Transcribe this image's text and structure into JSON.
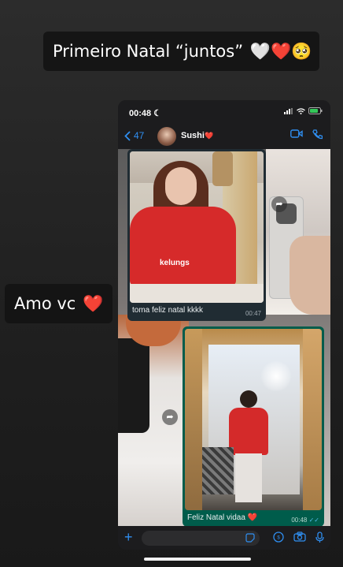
{
  "story": {
    "caption_top": "Primeiro Natal “juntos”",
    "caption_top_emoji": "🤍❤️🥺",
    "caption_mid": "Amo vc",
    "caption_mid_emoji": "❤️"
  },
  "status_bar": {
    "time": "00:48",
    "moon": "☾"
  },
  "chat_header": {
    "back_count": "47",
    "contact_name": "Sushi",
    "contact_emoji": "❤️"
  },
  "messages": [
    {
      "caption": "toma feliz natal kkkk",
      "time": "00:47",
      "direction": "incoming"
    },
    {
      "caption": "Feliz Natal vidaa",
      "caption_emoji": "❤️",
      "time": "00:48",
      "direction": "outgoing"
    }
  ],
  "icons": {
    "back": "chevron-left-icon",
    "video": "video-call-icon",
    "phone": "phone-call-icon",
    "plus": "plus-icon",
    "sticker": "sticker-icon",
    "payment": "payment-icon",
    "camera": "camera-icon",
    "mic": "microphone-icon"
  },
  "colors": {
    "accent": "#2f8ef0",
    "outgoing_bubble": "#005c4b",
    "incoming_bubble": "#202c33",
    "heart": "#e0272d"
  }
}
